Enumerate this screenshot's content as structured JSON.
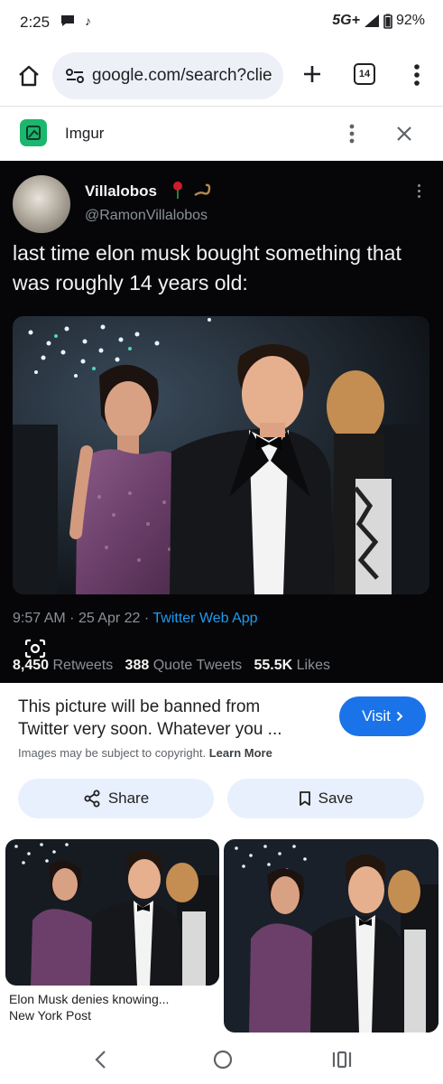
{
  "status_bar": {
    "time": "2:25",
    "network": "5G+",
    "battery": "92%"
  },
  "browser": {
    "url": "google.com/search?clie",
    "tab_count": "14"
  },
  "source": {
    "name": "Imgur"
  },
  "tweet": {
    "display_name": "Villalobos",
    "handle": "@RamonVillalobos",
    "text": "last time elon musk bought something that was roughly 14 years old:",
    "time": "9:57 AM",
    "date": "25 Apr 22",
    "client": "Twitter Web App",
    "retweets_count": "8,450",
    "retweets_label": "Retweets",
    "quotes_count": "388",
    "quotes_label": "Quote Tweets",
    "likes_count": "55.5K",
    "likes_label": "Likes"
  },
  "result": {
    "title": "This picture will be banned from Twitter very soon. Whatever you ...",
    "visit_label": "Visit",
    "copyright_notice": "Images may be subject to copyright.",
    "learn_more": "Learn More",
    "share_label": "Share",
    "save_label": "Save"
  },
  "related": [
    {
      "caption": "Elon Musk denies knowing...",
      "source": "New York Post"
    }
  ],
  "colors": {
    "accent": "#1a73e8",
    "button_bg": "#e8f0fe",
    "tweet_bg": "#060608",
    "twitter_link": "#1d9bf0",
    "imgur_green": "#1bb76e"
  },
  "icons": [
    "home-icon",
    "site-settings-icon",
    "plus-icon",
    "tabs-icon",
    "more-vert-icon",
    "imgur-logo",
    "close-icon",
    "lens-icon",
    "chevron-right-icon",
    "share-icon",
    "bookmark-icon",
    "back-icon",
    "home-circle-icon",
    "recents-icon"
  ]
}
